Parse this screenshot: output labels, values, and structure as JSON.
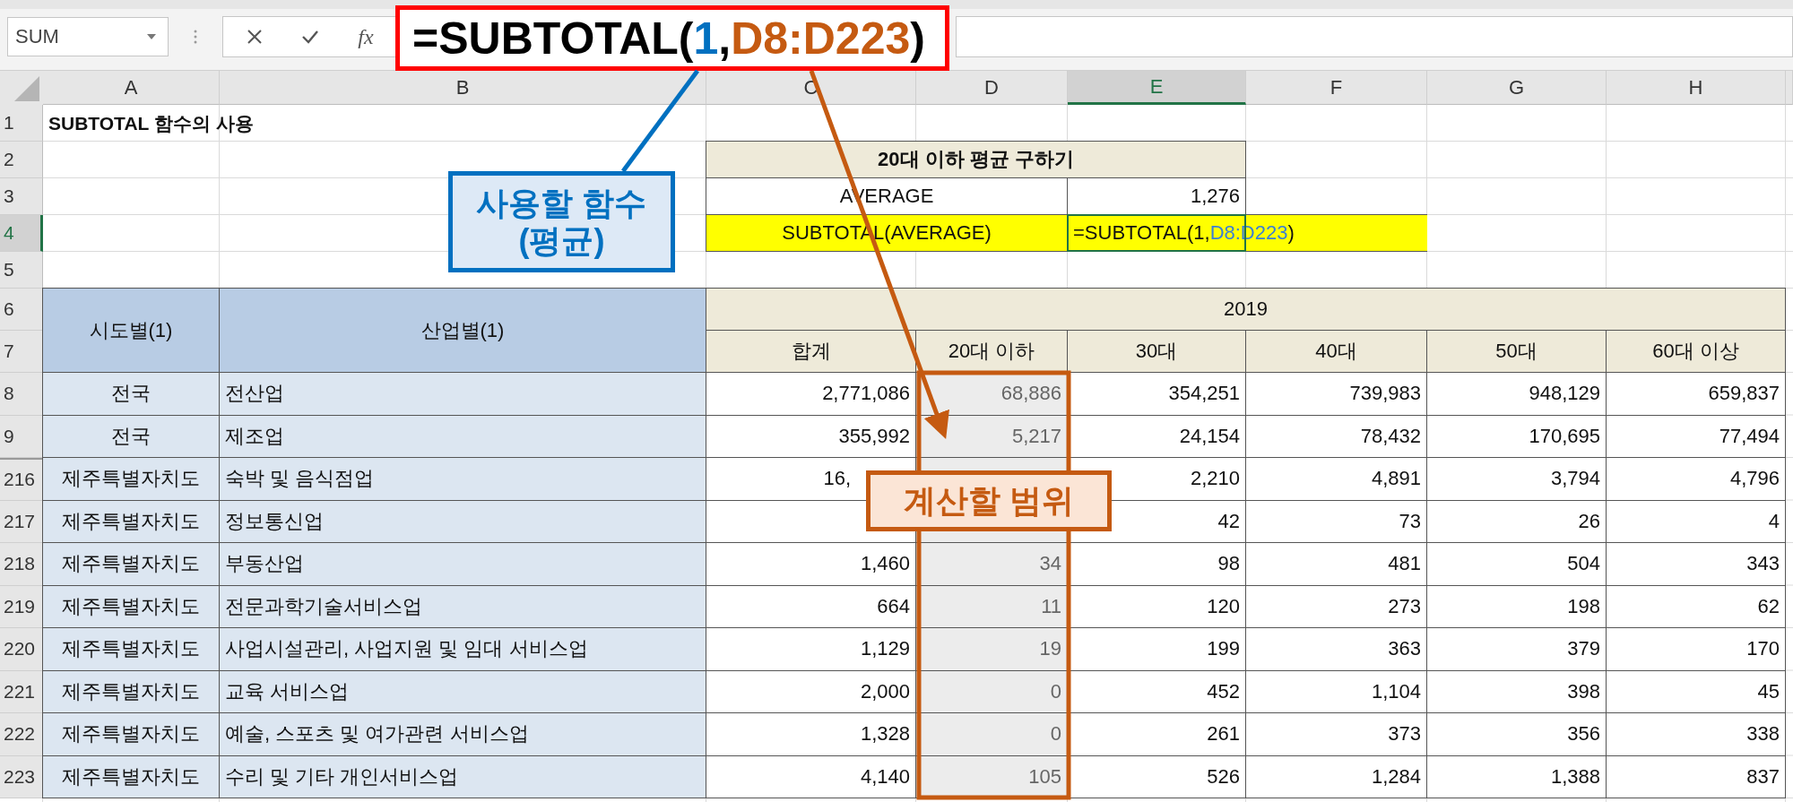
{
  "name_box": "SUM",
  "function_button": "fx",
  "formula_callout": {
    "parts": [
      {
        "text": "=SUBTOTAL(",
        "kind": "plain"
      },
      {
        "text": "1",
        "kind": "argument"
      },
      {
        "text": ",",
        "kind": "plain"
      },
      {
        "text": "D8:D223",
        "kind": "range"
      },
      {
        "text": ")",
        "kind": "plain"
      }
    ]
  },
  "column_headers": [
    {
      "label": "A",
      "selected": false
    },
    {
      "label": "B",
      "selected": false
    },
    {
      "label": "C",
      "selected": false
    },
    {
      "label": "D",
      "selected": false
    },
    {
      "label": "E",
      "selected": true
    },
    {
      "label": "F",
      "selected": false
    },
    {
      "label": "G",
      "selected": false
    },
    {
      "label": "H",
      "selected": false
    }
  ],
  "top_rows": [
    {
      "number": "1",
      "selected": false
    },
    {
      "number": "2",
      "selected": false
    },
    {
      "number": "3",
      "selected": false
    },
    {
      "number": "4",
      "selected": true
    },
    {
      "number": "5",
      "selected": false
    }
  ],
  "sheet_title": "SUBTOTAL 함수의 사용",
  "summary_table": {
    "title": "20대 이하 평균 구하기",
    "rows": [
      {
        "label": "AVERAGE",
        "highlighted": false,
        "value_parts": [
          {
            "text": "1,276",
            "kind": "plain"
          }
        ]
      },
      {
        "label": "SUBTOTAL(AVERAGE)",
        "highlighted": true,
        "value_parts": [
          {
            "text": "=SUBTOTAL(1,",
            "kind": "plain"
          },
          {
            "text": "D8:D223",
            "kind": "reference"
          },
          {
            "text": ")",
            "kind": "plain"
          }
        ]
      }
    ]
  },
  "data_table": {
    "header_rows": [
      {
        "number": "6",
        "selected": false
      },
      {
        "number": "7",
        "selected": false
      }
    ],
    "group_headers": [
      "시도별(1)",
      "산업별(1)"
    ],
    "year": "2019",
    "age_columns": [
      "합계",
      "20대 이하",
      "30대",
      "40대",
      "50대",
      "60대 이상"
    ],
    "rows": [
      {
        "number": "8",
        "region": "전국",
        "industry": "전산업",
        "values": {
          "total": "2,771,086",
          "under_20": "68,886",
          "age_30s": "354,251",
          "age_40s": "739,983",
          "age_50s": "948,129",
          "over_60": "659,837"
        }
      },
      {
        "number": "9",
        "region": "전국",
        "industry": "제조업",
        "values": {
          "total": "355,992",
          "under_20": "5,217",
          "age_30s": "24,154",
          "age_40s": "78,432",
          "age_50s": "170,695",
          "over_60": "77,494"
        }
      },
      {
        "number": "216",
        "region": "제주특별자치도",
        "industry": "숙박 및 음식점업",
        "values": {
          "total": "16,",
          "age_30s": "2,210",
          "age_40s": "4,891",
          "age_50s": "3,794",
          "over_60": "4,796"
        }
      },
      {
        "number": "217",
        "region": "제주특별자치도",
        "industry": "정보통신업",
        "values": {
          "age_30s": "42",
          "age_40s": "73",
          "age_50s": "26",
          "over_60": "4"
        }
      },
      {
        "number": "218",
        "region": "제주특별자치도",
        "industry": "부동산업",
        "values": {
          "total": "1,460",
          "under_20": "34",
          "age_30s": "98",
          "age_40s": "481",
          "age_50s": "504",
          "over_60": "343"
        }
      },
      {
        "number": "219",
        "region": "제주특별자치도",
        "industry": "전문과학기술서비스업",
        "values": {
          "total": "664",
          "under_20": "11",
          "age_30s": "120",
          "age_40s": "273",
          "age_50s": "198",
          "over_60": "62"
        }
      },
      {
        "number": "220",
        "region": "제주특별자치도",
        "industry": "사업시설관리, 사업지원 및 임대 서비스업",
        "values": {
          "total": "1,129",
          "under_20": "19",
          "age_30s": "199",
          "age_40s": "363",
          "age_50s": "379",
          "over_60": "170"
        }
      },
      {
        "number": "221",
        "region": "제주특별자치도",
        "industry": "교육 서비스업",
        "values": {
          "total": "2,000",
          "under_20": "0",
          "age_30s": "452",
          "age_40s": "1,104",
          "age_50s": "398",
          "over_60": "45"
        }
      },
      {
        "number": "222",
        "region": "제주특별자치도",
        "industry": "예술, 스포츠 및 여가관련 서비스업",
        "values": {
          "total": "1,328",
          "under_20": "0",
          "age_30s": "261",
          "age_40s": "373",
          "age_50s": "356",
          "over_60": "338"
        }
      },
      {
        "number": "223",
        "region": "제주특별자치도",
        "industry": "수리 및 기타 개인서비스업",
        "values": {
          "total": "4,140",
          "under_20": "105",
          "age_30s": "526",
          "age_40s": "1,284",
          "age_50s": "1,388",
          "over_60": "837"
        }
      }
    ]
  },
  "callouts": [
    {
      "kind": "function",
      "text": "사용할 함수\n(평균)"
    },
    {
      "kind": "range",
      "text": "계산할 범위"
    }
  ]
}
